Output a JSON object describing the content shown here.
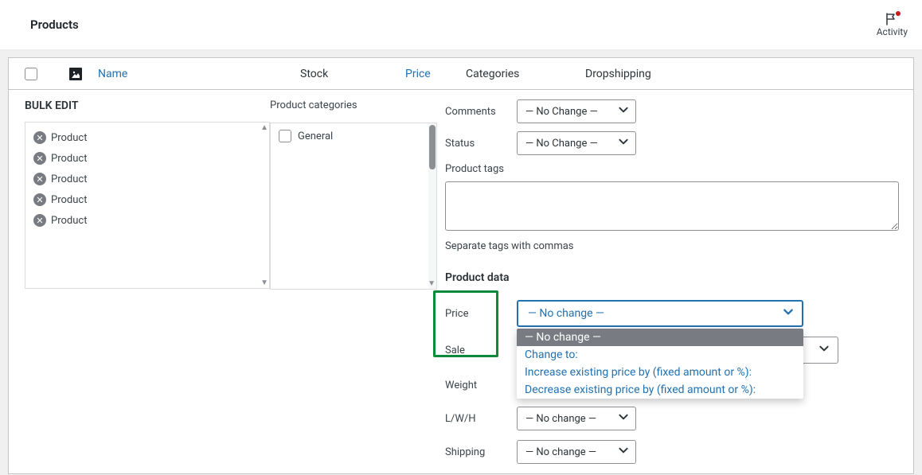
{
  "topbar": {
    "title": "Products",
    "activity_label": "Activity"
  },
  "columns": {
    "name": "Name",
    "stock": "Stock",
    "price": "Price",
    "categories": "Categories",
    "dropshipping": "Dropshipping"
  },
  "bulk_edit": {
    "title": "BULK EDIT",
    "products": [
      "Product",
      "Product",
      "Product",
      "Product",
      "Product"
    ]
  },
  "categories": {
    "title": "Product categories",
    "items": [
      "General"
    ]
  },
  "right": {
    "comments_label": "Comments",
    "status_label": "Status",
    "no_change_dash": "— No Change —",
    "product_tags_label": "Product tags",
    "tags_hint": "Separate tags with commas",
    "product_data_title": "Product data",
    "price_label": "Price",
    "sale_label": "Sale",
    "weight_label": "Weight",
    "lwh_label": "L/W/H",
    "shipping_label": "Shipping",
    "no_change_lower": "— No change —",
    "price_dropdown": {
      "selected": "— No change —",
      "options": [
        "— No change —",
        "Change to:",
        "Increase existing price by (fixed amount or %):",
        "Decrease existing price by (fixed amount or %):"
      ]
    }
  }
}
